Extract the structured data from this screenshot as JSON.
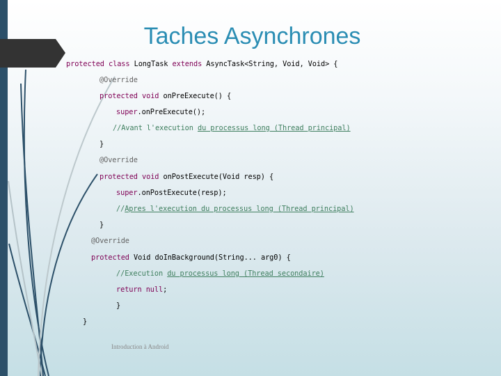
{
  "slide": {
    "title": "Taches Asynchrones",
    "footer": "Introduction à Android",
    "colors": {
      "title": "#2a8db3",
      "left_bar": "#2c5069",
      "arrow": "#333333",
      "keyword": "#7f0055",
      "annotation": "#646464",
      "comment": "#3f7f5f"
    }
  },
  "code": {
    "l1": {
      "kw": "protected class",
      "rest": " LongTask ",
      "kw2": "extends",
      "rest2": " AsyncTask<String, Void, Void> {"
    },
    "l2": "@Override",
    "l3": {
      "kw": "protected void",
      "rest": " onPreExecute() {"
    },
    "l4": {
      "kw": "super",
      "rest": ".onPreExecute();"
    },
    "l5": {
      "pre": "//Avant l'execution ",
      "ul": "du processus long (Thread principal)"
    },
    "l6": "}",
    "l7": "@Override",
    "l8": {
      "kw": "protected void",
      "rest": " onPostExecute(Void resp) {"
    },
    "l9": {
      "kw": "super",
      "rest": ".onPostExecute(resp);"
    },
    "l10": {
      "pre": "//",
      "ul": "Apres l'execution du processus long (Thread principal)"
    },
    "l11": "}",
    "l12": "@Override",
    "l13": {
      "kw": "protected",
      "rest": " Void doInBackground(String... arg0) {"
    },
    "l14": {
      "pre": "//Execution ",
      "ul": "du processus long (Thread secondaire)"
    },
    "l15": {
      "kw": "return null",
      "rest": ";"
    },
    "l16": "}",
    "l17": "}"
  }
}
